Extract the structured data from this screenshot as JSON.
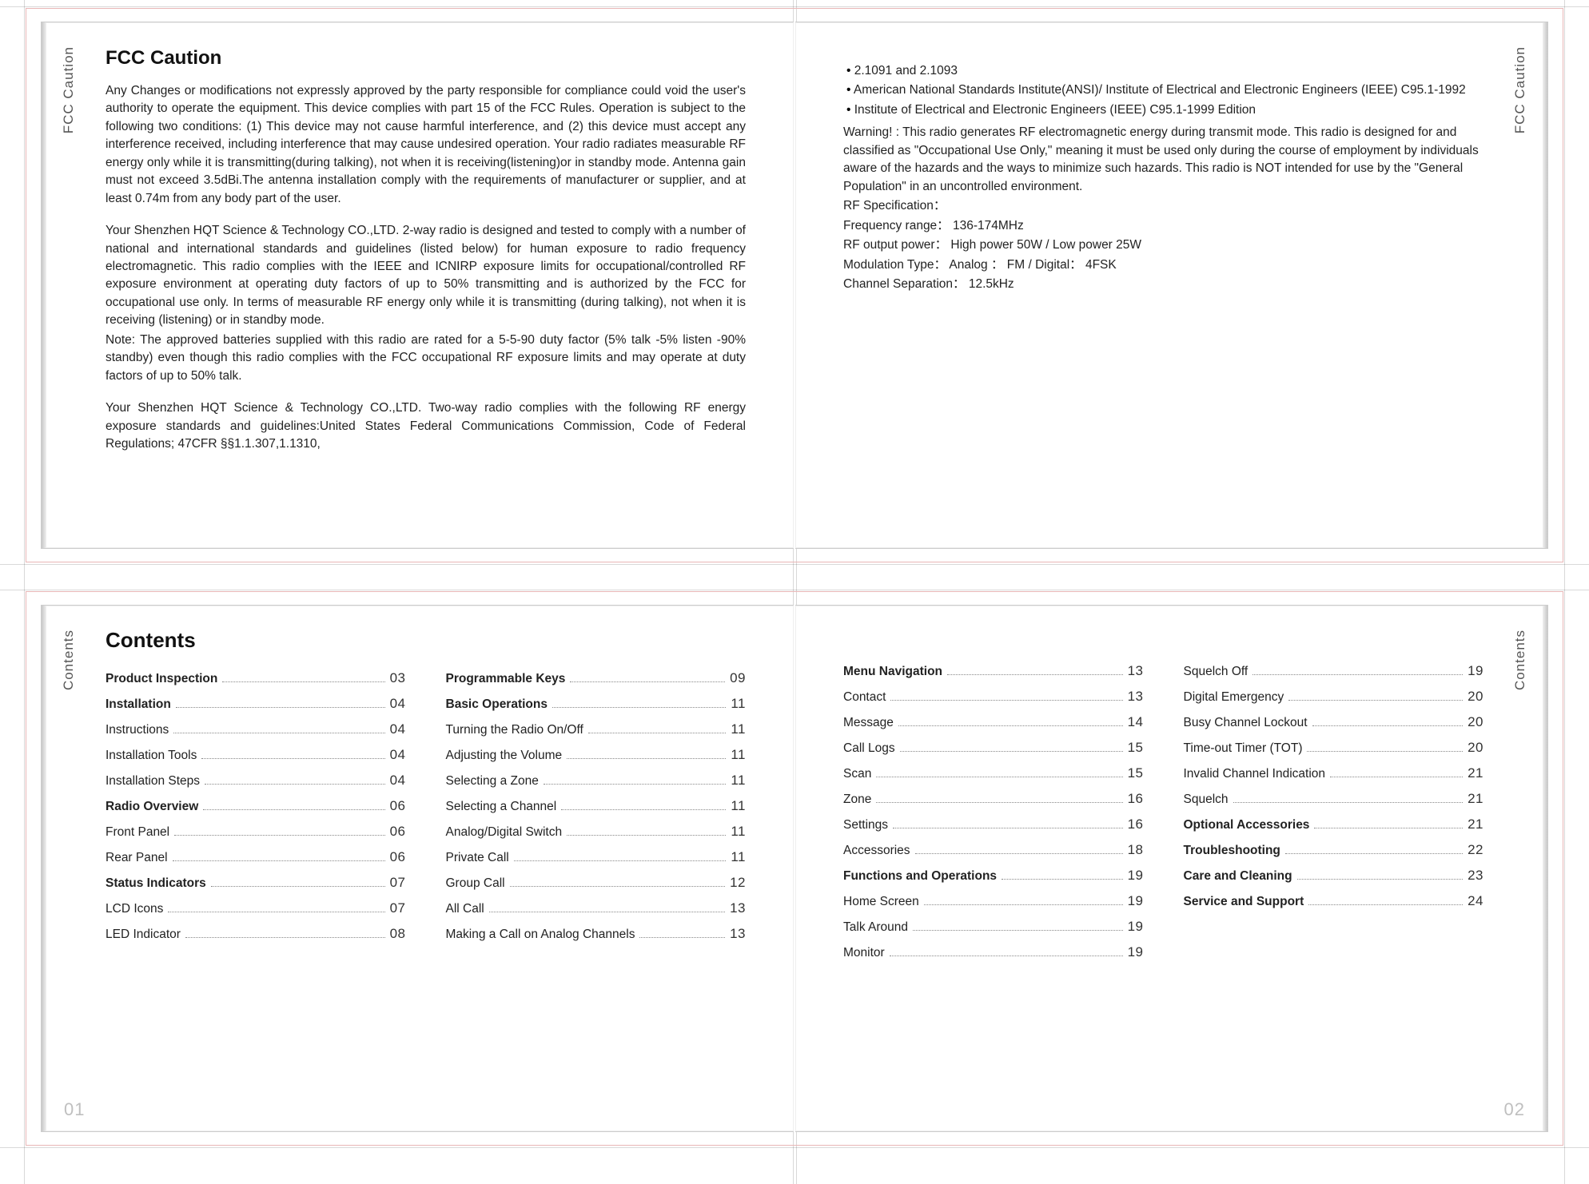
{
  "top_spread": {
    "side_tab": "FCC  Caution",
    "left_page": {
      "title": "FCC Caution",
      "para1": "Any Changes or modifications not expressly approved by the party responsible for compliance could void the user's  authority to operate the equipment. This device complies with part 15 of the FCC Rules. Operation is subject to the following two conditions: (1) This device may not cause harmful interference,  and (2) this device must accept any interference received, including interference that may cause undesired operation. Your radio radiates measurable RF energy  only  while  it  is  transmitting(during  talking),  not  when  it  is  receiving(listening)or  in  standby  mode.  Antenna gain must not exceed 3.5dBi.The antenna installation comply with the requirements of manufacturer or supplier, and at least 0.74m from any body part of the user.",
      "para2": "Your Shenzhen HQT Science & Technology CO.,LTD.  2-way radio is designed and tested to comply with a number of national and international standards and guidelines (listed below) for human exposure to radio frequency electromagnetic. This radio complies with the IEEE and ICNIRP exposure limits for occupational/controlled RF exposure environment at operating duty factors of up to 50% transmitting and is authorized by the FCC for occupational use only. In terms of measurable RF energy only while it is transmitting (during talking), not when it is receiving (listening) or in standby mode.",
      "para2b": "Note: The approved batteries supplied with this radio are rated for a 5-5-90 duty factor (5% talk -5% listen -90% standby) even though this radio complies with the FCC occupational RF exposure limits and may operate at duty factors of up to 50% talk.",
      "para3": "Your Shenzhen HQT Science & Technology CO.,LTD. Two-way radio complies with the following RF energy exposure standards and guidelines:United States Federal Communications Commission, Code of Federal Regulations; 47CFR §§1.1.307,1.1310,"
    },
    "right_page": {
      "bullets": [
        "2.1091 and 2.1093",
        "American National Standards Institute(ANSI)/ Institute of Electrical and Electronic Engineers (IEEE) C95.1-1992",
        "Institute of Electrical and Electronic Engineers (IEEE) C95.1-1999 Edition"
      ],
      "warning": "Warning! : This  radio generates RF electromagnetic energy during transmit mode. This radio is designed for and classified as \"Occupational Use Only,\" meaning it must be used only during the course of employment by individuals aware of the hazards and the ways to minimize such hazards. This radio is NOT intended for use by the \"General Population\" in an uncontrolled environment.",
      "spec_title": "RF Specification：",
      "spec_lines": [
        "Frequency range： 136-174MHz",
        "RF output power： High power 50W / Low power 25W",
        "Modulation Type： Analog ： FM / Digital：  4FSK",
        "Channel Separation： 12.5kHz"
      ]
    }
  },
  "bottom_spread": {
    "side_tab": "Contents",
    "title": "Contents",
    "page_left_num": "01",
    "page_right_num": "02",
    "cols": [
      [
        {
          "label": "Product Inspection",
          "pg": "03",
          "bold": true
        },
        {
          "label": "Installation",
          "pg": "04",
          "bold": true
        },
        {
          "label": "Instructions",
          "pg": "04"
        },
        {
          "label": "Installation Tools",
          "pg": "04"
        },
        {
          "label": "Installation Steps",
          "pg": "04"
        },
        {
          "label": "Radio Overview",
          "pg": "06",
          "bold": true
        },
        {
          "label": "Front Panel",
          "pg": "06"
        },
        {
          "label": "Rear Panel",
          "pg": "06"
        },
        {
          "label": "Status Indicators",
          "pg": "07",
          "bold": true
        },
        {
          "label": "LCD Icons",
          "pg": "07"
        },
        {
          "label": "LED Indicator",
          "pg": "08"
        }
      ],
      [
        {
          "label": "Programmable Keys",
          "pg": "09",
          "bold": true
        },
        {
          "label": "Basic Operations",
          "pg": "11",
          "bold": true
        },
        {
          "label": "Turning the Radio On/Off",
          "pg": "11"
        },
        {
          "label": "Adjusting the Volume",
          "pg": "11"
        },
        {
          "label": "Selecting a Zone",
          "pg": "11"
        },
        {
          "label": "Selecting a Channel",
          "pg": "11"
        },
        {
          "label": "Analog/Digital Switch",
          "pg": "11"
        },
        {
          "label": "Private Call",
          "pg": "11"
        },
        {
          "label": "Group Call",
          "pg": "12"
        },
        {
          "label": "All Call",
          "pg": "13"
        },
        {
          "label": "Making a Call on Analog Channels",
          "pg": "13"
        }
      ],
      [
        {
          "label": "Menu Navigation",
          "pg": "13",
          "bold": true
        },
        {
          "label": "Contact",
          "pg": "13"
        },
        {
          "label": "Message",
          "pg": "14"
        },
        {
          "label": "Call Logs",
          "pg": "15"
        },
        {
          "label": "Scan",
          "pg": "15"
        },
        {
          "label": "Zone",
          "pg": "16"
        },
        {
          "label": "Settings",
          "pg": "16"
        },
        {
          "label": "Accessories",
          "pg": "18"
        },
        {
          "label": "Functions and Operations",
          "pg": "19",
          "bold": true
        },
        {
          "label": "Home Screen",
          "pg": "19"
        },
        {
          "label": "Talk Around",
          "pg": "19"
        },
        {
          "label": "Monitor",
          "pg": "19"
        }
      ],
      [
        {
          "label": "Squelch Off",
          "pg": "19"
        },
        {
          "label": "Digital Emergency",
          "pg": "20"
        },
        {
          "label": "Busy Channel Lockout",
          "pg": "20"
        },
        {
          "label": "Time-out Timer (TOT)",
          "pg": "20"
        },
        {
          "label": "Invalid Channel Indication",
          "pg": "21"
        },
        {
          "label": "Squelch",
          "pg": "21"
        },
        {
          "label": "Optional Accessories",
          "pg": "21",
          "bold": true
        },
        {
          "label": "Troubleshooting",
          "pg": "22",
          "bold": true
        },
        {
          "label": "Care and Cleaning",
          "pg": "23",
          "bold": true
        },
        {
          "label": "Service and Support",
          "pg": "24",
          "bold": true
        }
      ]
    ]
  }
}
